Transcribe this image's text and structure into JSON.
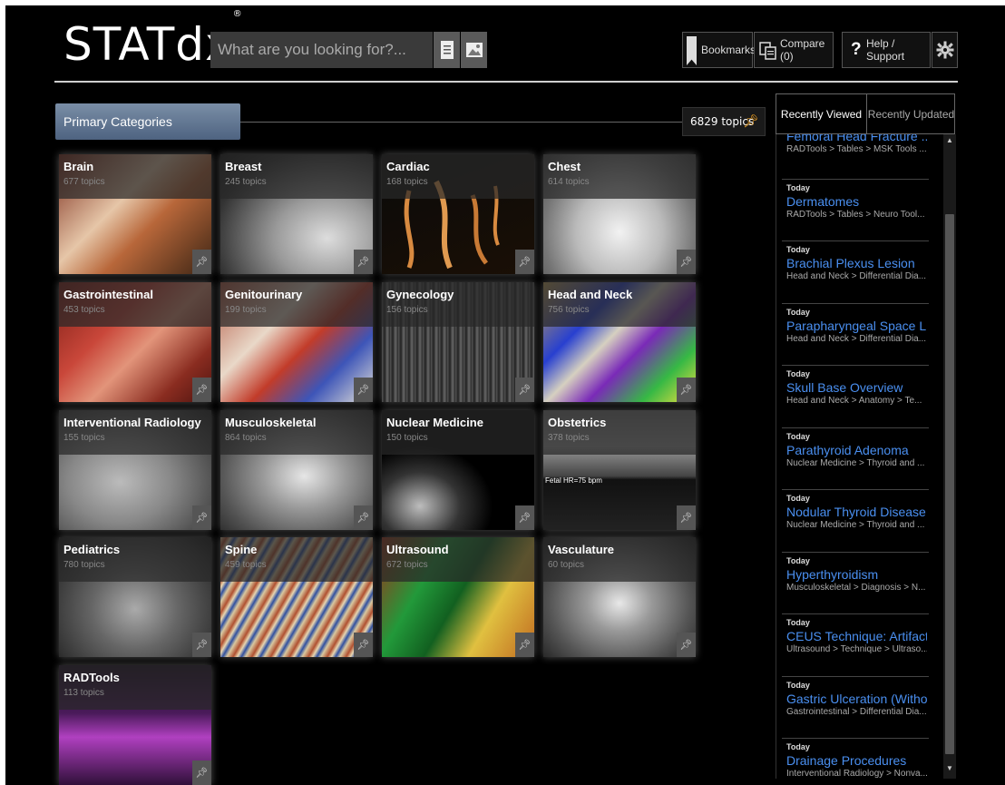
{
  "header": {
    "logo": "STATdx",
    "logo_mark": "®",
    "search_placeholder": "What are you looking for?...",
    "bookmarks": "Bookmarks",
    "compare": "Compare (0)",
    "help": "Help / Support",
    "help_glyph": "?"
  },
  "primary": {
    "title": "Primary Categories",
    "total": "6829 topics"
  },
  "tiles": [
    {
      "name": "Brain",
      "count": "677 topics"
    },
    {
      "name": "Breast",
      "count": "245 topics"
    },
    {
      "name": "Cardiac",
      "count": "168 topics"
    },
    {
      "name": "Chest",
      "count": "614 topics"
    },
    {
      "name": "Gastrointestinal",
      "count": "453 topics"
    },
    {
      "name": "Genitourinary",
      "count": "199 topics"
    },
    {
      "name": "Gynecology",
      "count": "156 topics"
    },
    {
      "name": "Head and Neck",
      "count": "756 topics"
    },
    {
      "name": "Interventional Radiology",
      "count": "155 topics"
    },
    {
      "name": "Musculoskeletal",
      "count": "864 topics"
    },
    {
      "name": "Nuclear Medicine",
      "count": "150 topics"
    },
    {
      "name": "Obstetrics",
      "count": "378 topics"
    },
    {
      "name": "Pediatrics",
      "count": "780 topics"
    },
    {
      "name": "Spine",
      "count": "459 topics"
    },
    {
      "name": "Ultrasound",
      "count": "672 topics"
    },
    {
      "name": "Vasculature",
      "count": "60 topics"
    },
    {
      "name": "RADTools",
      "count": "113 topics"
    }
  ],
  "obstetrics_overlay": "Fetal HR=75 bpm",
  "right_panel": {
    "tabs": [
      "Recently Viewed",
      "Recently Updated"
    ],
    "items": [
      {
        "date": "",
        "title": "Femoral Head Fracture ...",
        "path": "RADTools > Tables > MSK Tools ..."
      },
      {
        "date": "Today",
        "title": "Dermatomes",
        "path": "RADTools > Tables > Neuro Tool..."
      },
      {
        "date": "Today",
        "title": "Brachial Plexus Lesion",
        "path": "Head and Neck > Differential Dia..."
      },
      {
        "date": "Today",
        "title": "Parapharyngeal Space L...",
        "path": "Head and Neck > Differential Dia..."
      },
      {
        "date": "Today",
        "title": "Skull Base Overview",
        "path": "Head and Neck > Anatomy > Te..."
      },
      {
        "date": "Today",
        "title": "Parathyroid Adenoma",
        "path": "Nuclear Medicine > Thyroid and ..."
      },
      {
        "date": "Today",
        "title": "Nodular Thyroid Disease",
        "path": "Nuclear Medicine > Thyroid and ..."
      },
      {
        "date": "Today",
        "title": "Hyperthyroidism",
        "path": "Musculoskeletal > Diagnosis > N..."
      },
      {
        "date": "Today",
        "title": "CEUS Technique: Artifact...",
        "path": "Ultrasound > Technique > Ultraso..."
      },
      {
        "date": "Today",
        "title": "Gastric Ulceration (Witho...",
        "path": "Gastrointestinal > Differential Dia..."
      },
      {
        "date": "Today",
        "title": "Drainage Procedures",
        "path": "Interventional Radiology > Nonva..."
      }
    ]
  },
  "icons": {
    "pin": "pin-icon",
    "bookmark": "bookmark-icon",
    "compare": "compare-icon",
    "help": "help-icon",
    "gear": "gear-icon",
    "doc": "document-search-icon",
    "image": "image-search-icon"
  },
  "colors": {
    "accent_link": "#4a8ff0",
    "pin_orange": "#f0a020",
    "tab_blue": "#5a6f8e"
  }
}
